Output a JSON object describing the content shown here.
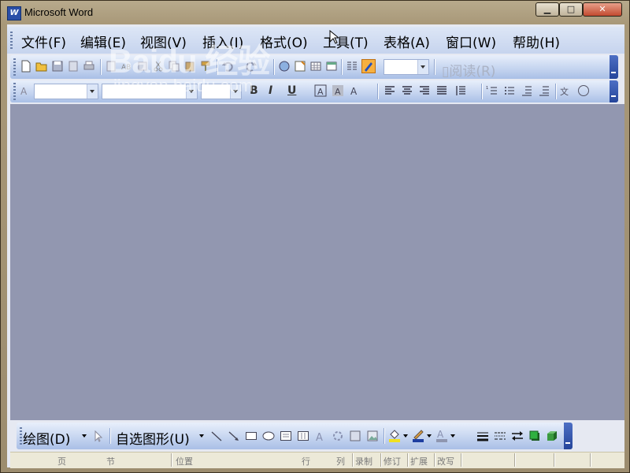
{
  "window": {
    "title": "Microsoft Word",
    "app_icon_letter": "W",
    "controls": [
      "minimize",
      "maximize",
      "close"
    ]
  },
  "menubar": {
    "items": [
      {
        "label": "文件(F)"
      },
      {
        "label": "编辑(E)"
      },
      {
        "label": "视图(V)"
      },
      {
        "label": "插入(I)"
      },
      {
        "label": "格式(O)"
      },
      {
        "label": "工具(T)"
      },
      {
        "label": "表格(A)"
      },
      {
        "label": "窗口(W)"
      },
      {
        "label": "帮助(H)"
      }
    ]
  },
  "standard_toolbar": {
    "read_button": "阅读(R)",
    "zoom_value": "",
    "icons": [
      "new-icon",
      "open-icon",
      "save-icon",
      "permission-icon",
      "print-icon",
      "print-preview-icon",
      "spelling-icon",
      "research-icon",
      "cut-icon",
      "copy-icon",
      "paste-icon",
      "format-painter-icon",
      "undo-icon",
      "redo-icon",
      "hyperlink-icon",
      "tables-borders-icon",
      "insert-table-icon",
      "insert-excel-icon",
      "columns-icon",
      "drawing-icon",
      "document-map-icon",
      "show-hide-icon"
    ]
  },
  "formatting_toolbar": {
    "style_value": "",
    "font_value": "",
    "size_value": "",
    "bold": "B",
    "italic": "I",
    "underline": "U",
    "icons": [
      "styles-formatting-icon",
      "bold-icon",
      "italic-icon",
      "underline-icon",
      "char-border-icon",
      "char-shading-icon",
      "scale-icon",
      "align-left-icon",
      "center-icon",
      "align-right-icon",
      "justify-icon",
      "line-spacing-icon",
      "numbering-icon",
      "bullets-icon",
      "decrease-indent-icon",
      "increase-indent-icon",
      "phonetic-guide-icon",
      "enclose-char-icon"
    ]
  },
  "drawing_toolbar": {
    "draw_label": "绘图(D)",
    "autoshapes_label": "自选图形(U)",
    "icons": [
      "select-objects-icon",
      "line-icon",
      "arrow-icon",
      "rectangle-icon",
      "oval-icon",
      "textbox-icon",
      "vertical-textbox-icon",
      "wordart-icon",
      "diagram-icon",
      "clipart-icon",
      "picture-icon",
      "fill-color-icon",
      "line-color-icon",
      "font-color-icon",
      "line-style-icon",
      "dash-style-icon",
      "arrow-style-icon",
      "shadow-icon",
      "3d-icon"
    ],
    "fill_color": "#f0e020",
    "line_color": "#1e3ea0",
    "font_color": "#8f96b0"
  },
  "statusbar": {
    "page": "页",
    "section": "节",
    "position": "位置",
    "line": "行",
    "column": "列",
    "rec": "录制",
    "trk": "修订",
    "ext": "扩展",
    "ovr": "改写"
  },
  "watermark": {
    "logo": "Baidu 经验",
    "url": "jingyan.baidu.com"
  },
  "colors": {
    "document_background": "#9297b0",
    "toolbar_accent": "#25459a"
  }
}
